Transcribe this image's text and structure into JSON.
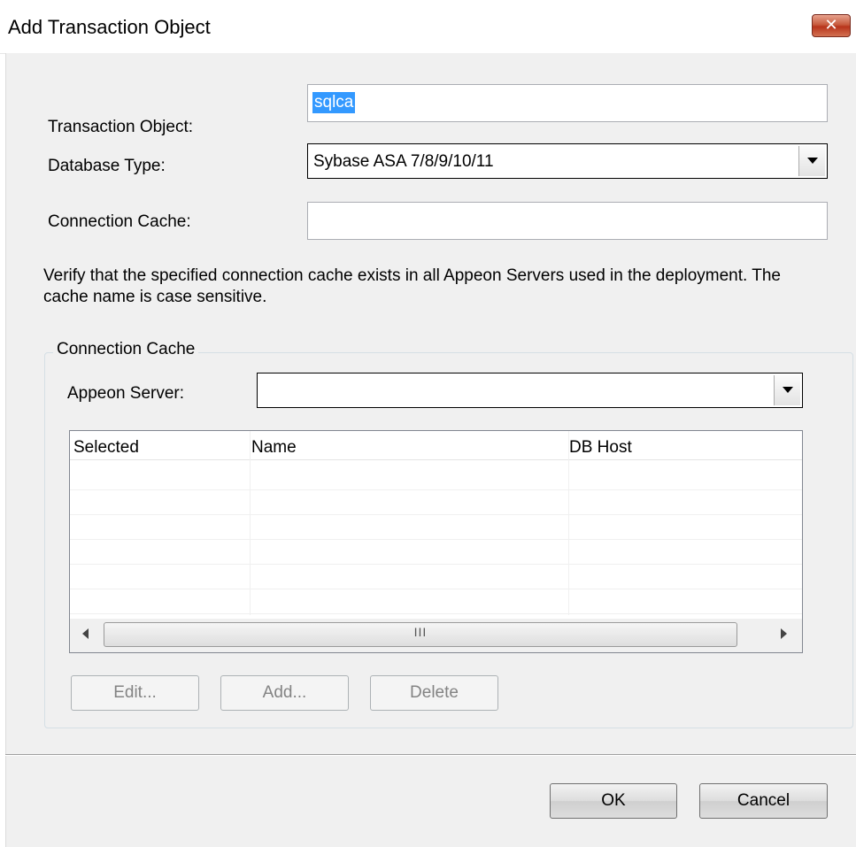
{
  "window": {
    "title": "Add Transaction Object",
    "close_glyph": "✕"
  },
  "form": {
    "transaction_object_label": "Transaction Object:",
    "transaction_object_value": "sqlca",
    "database_type_label": "Database Type:",
    "database_type_value": "Sybase ASA 7/8/9/10/11",
    "connection_cache_label": "Connection Cache:",
    "connection_cache_value": ""
  },
  "note": "Verify that the specified connection cache exists in all Appeon Servers used in the deployment.  The cache name is case sensitive.",
  "connection_cache_group": {
    "title": "Connection Cache",
    "appeon_server_label": "Appeon Server:",
    "appeon_server_value": "",
    "columns": [
      "Selected",
      "Name",
      "DB Host"
    ],
    "scroll_grip": "III",
    "buttons": {
      "edit": "Edit...",
      "add": "Add...",
      "delete": "Delete"
    }
  },
  "footer": {
    "ok": "OK",
    "cancel": "Cancel"
  },
  "colors": {
    "selection": "#3399ff",
    "dialog_bg": "#f0f0f0",
    "close_button": "#c75b3e"
  },
  "icons": {
    "close": "close-icon",
    "dropdown": "chevron-down-icon",
    "scroll_left": "arrow-left-icon",
    "scroll_right": "arrow-right-icon"
  }
}
